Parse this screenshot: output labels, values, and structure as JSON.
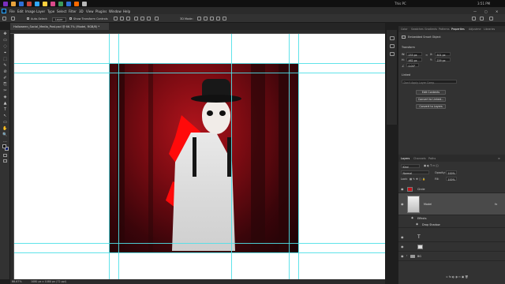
{
  "taskbar": {
    "right_label": "This PC",
    "clock": "3:51 PM",
    "search_label": "3D Mode"
  },
  "colors": {
    "taskbar_icons": [
      "#7b2fbe",
      "#e8a33d",
      "#2f6fd6",
      "#c8463b",
      "#31a8ff",
      "#ffcf3d",
      "#d94b8a",
      "#3d9b5a",
      "#2f6fd6",
      "#ff6a00",
      "#b8b8b8"
    ]
  },
  "menu": [
    "File",
    "Edit",
    "Image",
    "Layer",
    "Type",
    "Select",
    "Filter",
    "3D",
    "View",
    "Plugins",
    "Window",
    "Help"
  ],
  "options": {
    "auto_select": "Auto-Select:",
    "layer_dropdown": "Layer",
    "transform_controls": "Show Transform Controls",
    "mode_3d": "3D Mode:"
  },
  "document": {
    "tab_title": "Halloween_Social_Media_Post.psd @ 66.7% (Model, RGB/8) *"
  },
  "status": {
    "zoom": "66.67%",
    "doc_info": "1080 px x 1080 px (72 ppi)"
  },
  "tools": [
    "✥",
    "▭",
    "◌",
    "⌖",
    "⬚",
    "✎",
    "⊘",
    "✐",
    "⎘",
    "✂",
    "◈",
    "▲",
    "T",
    "↖",
    "▭",
    "✋",
    "🔍",
    "…"
  ],
  "panel_tabs": [
    "Color",
    "Swatches",
    "Gradients",
    "Patterns",
    "Properties",
    "Adjustme",
    "Libraries"
  ],
  "properties": {
    "type_label": "Embedded Smart Object",
    "transform_label": "Transform",
    "w_label": "W:",
    "w_value": "233 px",
    "x_label": "X:",
    "x_value": "501 px",
    "h_label": "H:",
    "h_value": "462 px",
    "y_label": "Y:",
    "y_value": "229 px",
    "angle_value": "0.00°",
    "linked": "Linked",
    "placeholder": "Don't Apply Layer Comp",
    "edit_contents": "Edit Contents",
    "convert_linked": "Convert to Linked...",
    "convert_layers": "Convert to Layers"
  },
  "layers_tabs": [
    "Layers",
    "Channels",
    "Paths"
  ],
  "layers": {
    "filter_kind": "Kind",
    "blend_mode": "Normal",
    "opacity_label": "Opacity:",
    "opacity_value": "100%",
    "lock_label": "Lock:",
    "fill_label": "Fill:",
    "fill_value": "100%",
    "rows": [
      {
        "name": "Circle",
        "kind": "shape",
        "visible": true
      },
      {
        "name": "Model",
        "kind": "smart-object",
        "visible": true,
        "selected": true
      },
      {
        "name": "Effects",
        "kind": "effects"
      },
      {
        "name": "Drop Shadow",
        "kind": "effect"
      },
      {
        "name": "",
        "kind": "text",
        "visible": true
      },
      {
        "name": "",
        "kind": "group",
        "visible": true
      },
      {
        "name": "BG",
        "kind": "group",
        "visible": true
      }
    ]
  }
}
